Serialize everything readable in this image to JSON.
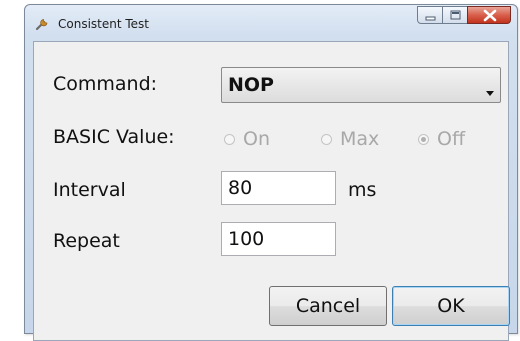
{
  "window": {
    "title": "Consistent Test",
    "icon": "wrench-icon"
  },
  "caption_buttons": {
    "minimize_icon": "minimize-icon",
    "maximize_icon": "maximize-icon",
    "close_icon": "close-icon",
    "close_color": "#c2331c"
  },
  "form": {
    "command_label": "Command:",
    "command_value": "NOP",
    "basic_value_label": "BASIC Value:",
    "basic_options": [
      {
        "label": "On",
        "checked": false,
        "enabled": false
      },
      {
        "label": "Max",
        "checked": false,
        "enabled": false
      },
      {
        "label": "Off",
        "checked": true,
        "enabled": false
      }
    ],
    "interval_label": "Interval",
    "interval_value": "80",
    "interval_unit": "ms",
    "repeat_label": "Repeat",
    "repeat_value": "100"
  },
  "buttons": {
    "cancel_label": "Cancel",
    "ok_label": "OK"
  }
}
